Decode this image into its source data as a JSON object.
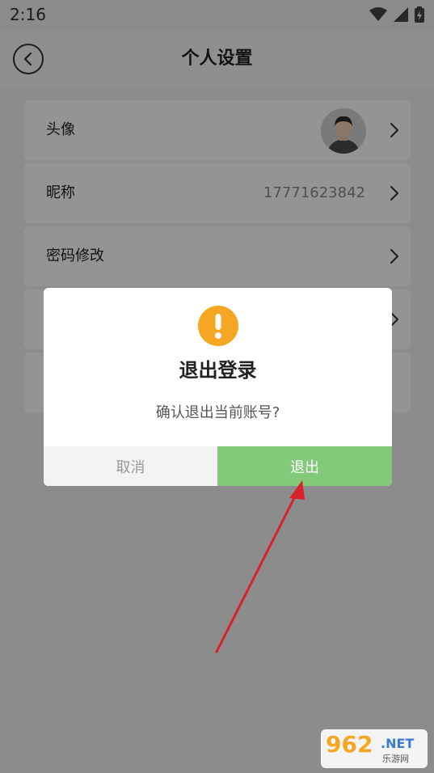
{
  "status_bar": {
    "time": "2:16"
  },
  "header": {
    "title": "个人设置"
  },
  "settings": {
    "avatar_label": "头像",
    "nickname_label": "昵称",
    "nickname_value": "17771623842",
    "password_label": "密码修改"
  },
  "dialog": {
    "title": "退出登录",
    "message": "确认退出当前账号?",
    "cancel_label": "取消",
    "confirm_label": "退出"
  },
  "watermark": {
    "number": "962",
    "net": ".NET",
    "subtitle": "乐游网"
  },
  "colors": {
    "confirm": "#83c97a",
    "warning": "#f5a623",
    "annotation_arrow": "#d9212a"
  }
}
